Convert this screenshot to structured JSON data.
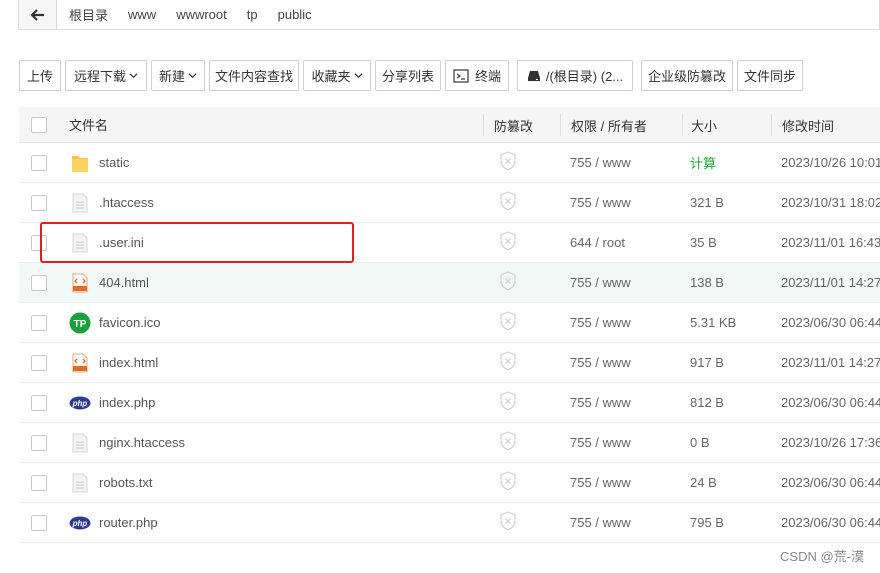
{
  "breadcrumb": {
    "items": [
      "根目录",
      "www",
      "wwwroot",
      "tp",
      "public"
    ]
  },
  "toolbar": {
    "upload": "上传",
    "remote_download": "远程下载",
    "new": "新建",
    "search_content": "文件内容查找",
    "favorites": "收藏夹",
    "share_list": "分享列表",
    "terminal": "终端",
    "disk": "/(根目录) (2...",
    "tamper_proof": "企业级防篡改",
    "file_sync": "文件同步"
  },
  "table": {
    "headers": {
      "name": "文件名",
      "protect": "防篡改",
      "permission": "权限 / 所有者",
      "size": "大小",
      "mtime": "修改时间"
    },
    "rows": [
      {
        "name": "static",
        "icon": "folder-icon",
        "perm": "755 / www",
        "size": "计算",
        "time": "2023/10/26 10:01"
      },
      {
        "name": ".htaccess",
        "icon": "file-icon",
        "perm": "755 / www",
        "size": "321 B",
        "time": "2023/10/31 18:02"
      },
      {
        "name": ".user.ini",
        "icon": "file-icon",
        "perm": "644 / root",
        "size": "35 B",
        "time": "2023/11/01 16:43"
      },
      {
        "name": "404.html",
        "icon": "html-icon",
        "perm": "755 / www",
        "size": "138 B",
        "time": "2023/11/01 14:27"
      },
      {
        "name": "favicon.ico",
        "icon": "tp-icon",
        "perm": "755 / www",
        "size": "5.31 KB",
        "time": "2023/06/30 06:44"
      },
      {
        "name": "index.html",
        "icon": "html-icon",
        "perm": "755 / www",
        "size": "917 B",
        "time": "2023/11/01 14:27"
      },
      {
        "name": "index.php",
        "icon": "php-icon",
        "perm": "755 / www",
        "size": "812 B",
        "time": "2023/06/30 06:44"
      },
      {
        "name": "nginx.htaccess",
        "icon": "file-icon",
        "perm": "755 / www",
        "size": "0 B",
        "time": "2023/10/26 17:36"
      },
      {
        "name": "robots.txt",
        "icon": "file-icon",
        "perm": "755 / www",
        "size": "24 B",
        "time": "2023/06/30 06:44"
      },
      {
        "name": "router.php",
        "icon": "php-icon",
        "perm": "755 / www",
        "size": "795 B",
        "time": "2023/06/30 06:44"
      }
    ]
  },
  "colors": {
    "accent_green": "#20a53a",
    "highlight_red": "#e02020",
    "hover_row": "#f1f8f5"
  },
  "watermark": "CSDN @荒-漠"
}
